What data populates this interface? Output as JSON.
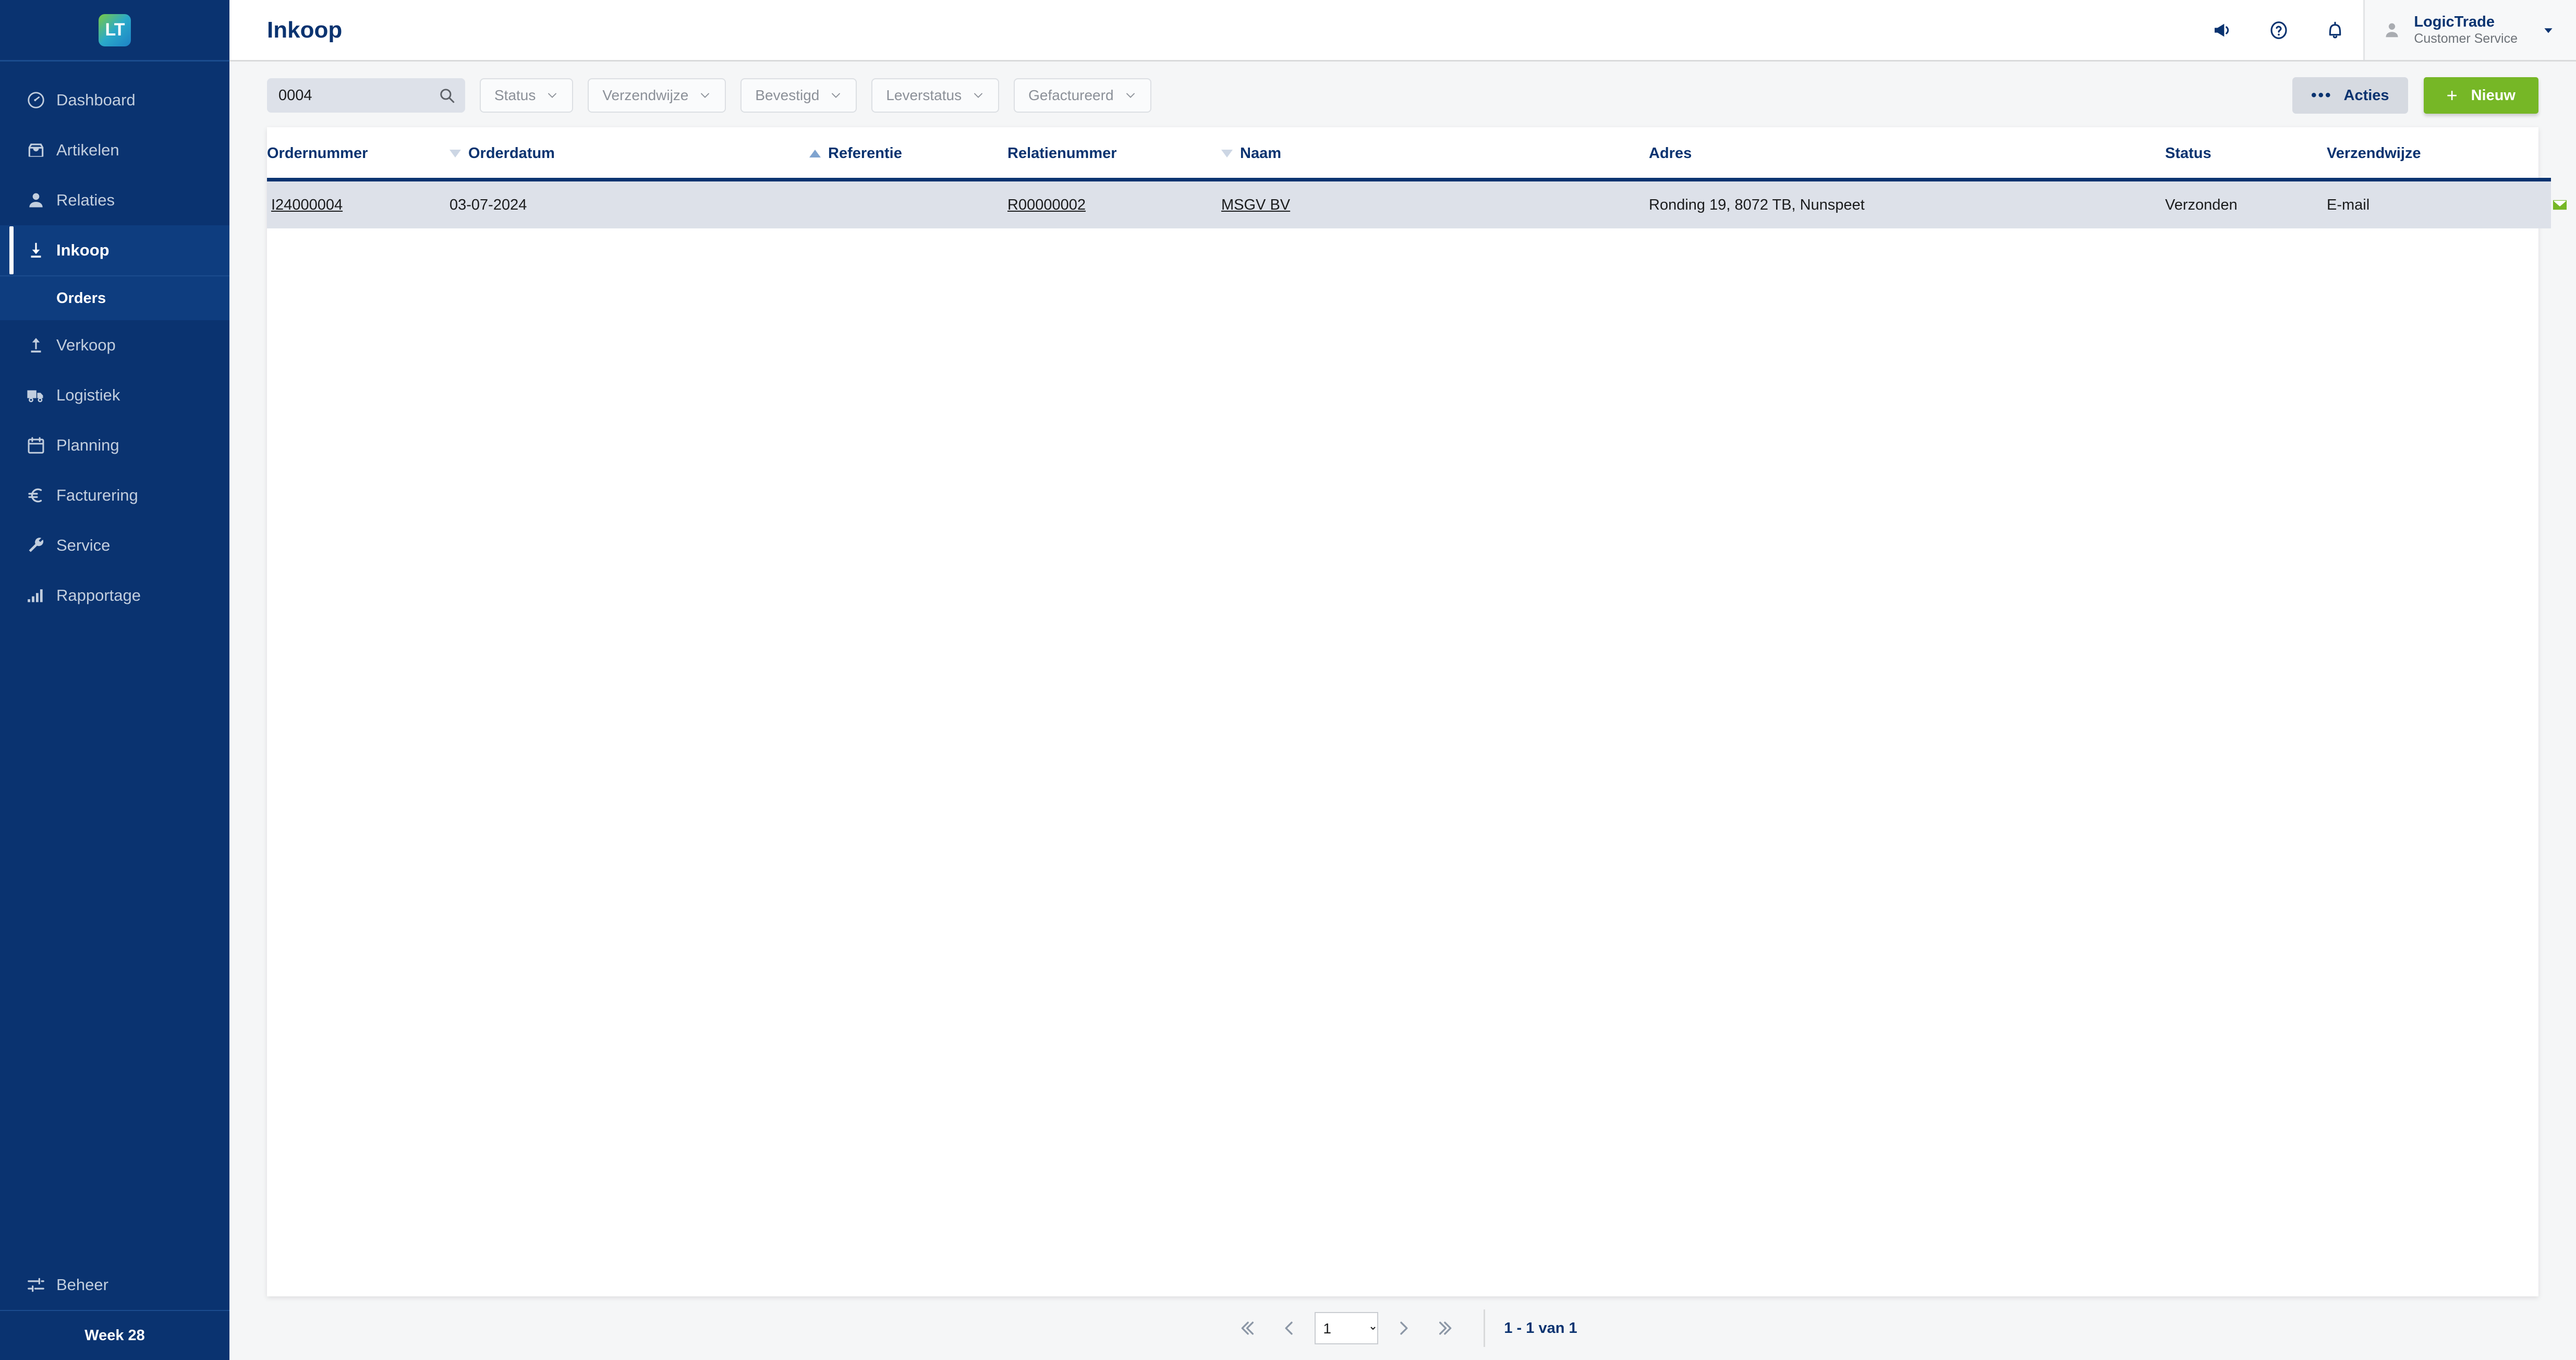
{
  "brand": {
    "logo_text": "LT",
    "accent_blue": "#0a3370",
    "accent_green": "#76b726"
  },
  "sidebar": {
    "items": [
      {
        "label": "Dashboard",
        "icon": "gauge-icon"
      },
      {
        "label": "Artikelen",
        "icon": "inbox-icon"
      },
      {
        "label": "Relaties",
        "icon": "user-icon"
      },
      {
        "label": "Inkoop",
        "icon": "download-arrow-icon",
        "active": true
      },
      {
        "label": "Verkoop",
        "icon": "upload-arrow-icon"
      },
      {
        "label": "Logistiek",
        "icon": "truck-icon"
      },
      {
        "label": "Planning",
        "icon": "calendar-icon"
      },
      {
        "label": "Facturering",
        "icon": "euro-icon"
      },
      {
        "label": "Service",
        "icon": "wrench-icon"
      },
      {
        "label": "Rapportage",
        "icon": "bar-chart-icon"
      }
    ],
    "subitems": [
      {
        "label": "Orders",
        "parent": "Inkoop",
        "active": true
      }
    ],
    "admin": {
      "label": "Beheer",
      "icon": "sliders-icon"
    },
    "footer": {
      "label": "Week 28"
    }
  },
  "header": {
    "title": "Inkoop",
    "icons": [
      {
        "name": "megaphone-icon"
      },
      {
        "name": "help-circle-icon"
      },
      {
        "name": "bell-icon"
      }
    ],
    "user": {
      "avatar": "user-avatar-icon",
      "name": "LogicTrade",
      "role": "Customer Service",
      "caret": "chevron-down-icon"
    }
  },
  "toolbar": {
    "search": {
      "value": "0004",
      "placeholder": "",
      "icon": "search-icon"
    },
    "filters": [
      {
        "label": "Status"
      },
      {
        "label": "Verzendwijze"
      },
      {
        "label": "Bevestigd"
      },
      {
        "label": "Leverstatus"
      },
      {
        "label": "Gefactureerd"
      }
    ],
    "actions_button": {
      "label": "Acties",
      "icon": "dots-icon"
    },
    "new_button": {
      "label": "Nieuw",
      "icon": "plus-icon"
    }
  },
  "table": {
    "columns": [
      {
        "label": "Ordernummer",
        "sort": "none"
      },
      {
        "label": "Orderdatum",
        "sort": "desc"
      },
      {
        "label": "Referentie",
        "sort": "asc"
      },
      {
        "label": "Relatienummer",
        "sort": "none"
      },
      {
        "label": "Naam",
        "sort": "desc"
      },
      {
        "label": "Adres",
        "sort": "none"
      },
      {
        "label": "Status",
        "sort": "none"
      },
      {
        "label": "Verzendwijze",
        "sort": "none"
      }
    ],
    "rows": [
      {
        "ordernummer": "I24000004",
        "orderdatum": "03-07-2024",
        "referentie": "",
        "relatienummer": "R00000002",
        "naam": "MSGV BV",
        "adres": "Ronding 19, 8072 TB, Nunspeet",
        "status": "Verzonden",
        "verzendwijze": "E-mail",
        "actions": [
          {
            "name": "email-icon",
            "color": "#76b726"
          },
          {
            "name": "archive-icon",
            "color": "#f0392b"
          },
          {
            "name": "euro-icon",
            "color": "#f0392b"
          }
        ]
      }
    ]
  },
  "pagination": {
    "first": "first-page-icon",
    "prev": "previous-page-icon",
    "current_page": "1",
    "page_options": [
      "1"
    ],
    "next": "next-page-icon",
    "last": "last-page-icon",
    "count_label": "1 - 1 van 1"
  }
}
